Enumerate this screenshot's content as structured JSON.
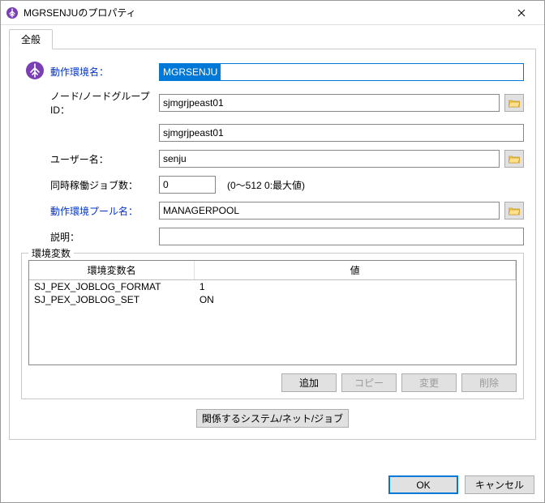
{
  "title": "MGRSENJUのプロパティ",
  "tab": {
    "general": "全般"
  },
  "form": {
    "env_name_label": "動作環境名：",
    "env_name_value": "MGRSENJU",
    "node_label": "ノード/ノードグループID：",
    "node_value": "sjmgrjpeast01",
    "node_display": "sjmgrjpeast01",
    "user_label": "ユーザー名：",
    "user_value": "senju",
    "jobcount_label": "同時稼働ジョブ数：",
    "jobcount_value": "0",
    "jobcount_hint": "(0～512 0:最大値)",
    "pool_label": "動作環境プール名：",
    "pool_value": "MANAGERPOOL",
    "desc_label": "説明：",
    "desc_value": ""
  },
  "envvars": {
    "group_label": "環境変数",
    "col_name": "環境変数名",
    "col_value": "値",
    "rows": [
      {
        "name": "SJ_PEX_JOBLOG_FORMAT",
        "value": "1"
      },
      {
        "name": "SJ_PEX_JOBLOG_SET",
        "value": "ON"
      }
    ],
    "buttons": {
      "add": "追加",
      "copy": "コピー",
      "edit": "変更",
      "delete": "削除"
    }
  },
  "related_button": "関係するシステム/ネット/ジョブ",
  "footer": {
    "ok": "OK",
    "cancel": "キャンセル"
  },
  "icons": {
    "app": "app-icon",
    "close": "×",
    "folder": "folder-icon"
  }
}
